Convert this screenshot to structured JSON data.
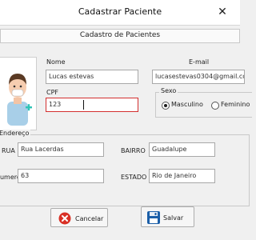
{
  "window": {
    "title": "Cadastrar Paciente",
    "close_glyph": "✕"
  },
  "header": {
    "title": "Cadastro de Pacientes"
  },
  "form": {
    "nome_label": "Nome",
    "nome_value": "Lucas estevas",
    "email_label": "E-mail",
    "email_value": "lucasestevas0304@gmail.co",
    "cpf_label": "CPF",
    "cpf_value": "123",
    "sexo_label": "Sexo",
    "sexo_options": [
      "Masculino",
      "Feminino"
    ],
    "sexo_selected": "Masculino"
  },
  "endereco": {
    "legend": "Endereço",
    "rua_label": "RUA",
    "rua_value": "Rua Lacerdas",
    "bairro_label": "BAIRRO",
    "bairro_value": "Guadalupe",
    "numero_label": "Numero",
    "numero_value": "63",
    "estado_label": "ESTADO",
    "estado_value": "Rio de Janeiro"
  },
  "buttons": {
    "cancel_label": "Cancelar",
    "save_label": "Salvar"
  },
  "colors": {
    "focus_border": "#d32f2f",
    "cancel_icon": "#d93025",
    "save_icon": "#1c5fa8"
  }
}
